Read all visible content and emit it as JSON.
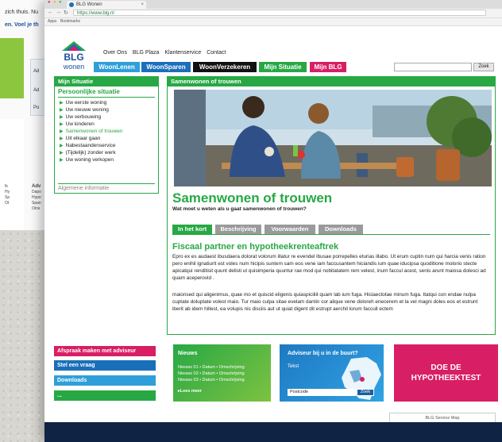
{
  "background": {
    "line1": "zich thuis. Nu",
    "line2": "en. Voel je th",
    "box_lines": [
      "Ad",
      "Ad",
      "Po"
    ],
    "mini_left": [
      "Ik",
      "Hy",
      "Sp",
      "Ot"
    ],
    "mini_head": "Adv",
    "mini_right": [
      "Dapo",
      "Hypo",
      "Span",
      "Oins"
    ]
  },
  "browser": {
    "tab_title": "BLG Wonen",
    "url": "https://www.blg.nl",
    "bookmarks": [
      "Apps",
      "Bookmarks"
    ]
  },
  "logo": {
    "top": "BLG",
    "bottom": "wonen"
  },
  "topnav": [
    "Over Ons",
    "BLG Plaza",
    "Klantenservice",
    "Contact"
  ],
  "mainnav": [
    {
      "label": "WoonLenen",
      "color": "#2e9fd9"
    },
    {
      "label": "WoonSparen",
      "color": "#1a6fba"
    },
    {
      "label": "WoonVerzekeren",
      "color": "#111111"
    },
    {
      "label": "Mijn Situatie",
      "color": "#27a844"
    },
    {
      "label": "Mijn BLG",
      "color": "#d81e64"
    }
  ],
  "search": {
    "value": "",
    "button": "Zoek"
  },
  "sidebar": {
    "header": "Mijn Situatie",
    "subheader": "Persoonlijke situatie",
    "items": [
      "Uw eerste woning",
      "Uw nieuwe woning",
      "Uw verbouwing",
      "Uw kinderen",
      "Samenwonen of trouwen",
      "Uit elkaar gaan",
      "Nabestaandenservice",
      "(Tijdelijk) zonder werk",
      "Uw woning verkopen"
    ],
    "footer": "Algemene informatie"
  },
  "content": {
    "header": "Samenwonen of trouwen",
    "title": "Samenwonen of trouwen",
    "subtitle": "Wat moet u weten als u gaat samenwonen of trouwen?",
    "tabs": [
      "In het kort",
      "Beschrijving",
      "Voorwaarden",
      "Downloads"
    ],
    "article_title": "Fiscaal partner en hypotheekrenteaftrek",
    "para1": "Epro ex es audaest ibusdaera dolorat volorum illatur re evendel ibusae porrepelles eturias illabo. Ut erum cuptin num qui harcia venis ration pero enihil ignatiurit est voles num hicipis suntem sam eos vene iam faccusantem hiciandis ium quae iducipsa quoditione molorio stecte apicatqui renditisit quunt delisti ut quisimperia quuntur rae mod qui nobitatatem rem velest, inum faccul acest, senis arunt maiosa dolesci ad quam aceperovid .",
    "para2": "maionsed qui aligenimus, quae mo et quiscid eligenis quiaspiciliit quam lab ium fuga. Hiciaectotae minum fuga. Itatqui con endae nulpa cuptate doluptate volest maio. Tur maio culpa sitae evelam dantin cor alique vene doloreh enecerem et la vel magni doles eos et estrunt iberit ab idem hillest, ea volupis nis disciis aut ut quiat digent dit estrupt aerchil lorum faccull ectem"
  },
  "bottom": {
    "buttons": [
      {
        "label": "Afspraak maken met adviseur",
        "color": "#d81e64"
      },
      {
        "label": "Stel een vraag",
        "color": "#1a6fba"
      },
      {
        "label": "Downloads",
        "color": "#2e9fd9"
      },
      {
        "label": "...",
        "color": "#27a844"
      }
    ],
    "nieuws": {
      "title": "Nieuws",
      "items": [
        "Nieuws 01 • Datum • Omschrijving",
        "Nieuws 02 • Datum • Omschrijving",
        "Nieuws 03 • Datum • Omschrijving"
      ],
      "more": "Lees meer"
    },
    "advies": {
      "title": "Adviseur bij u in de buurt?",
      "text": "Tekst",
      "postcode": "Postcode",
      "button": "Zoek"
    },
    "hypo": [
      "DOE DE",
      "HYPOTHEEKTEST"
    ],
    "servicemap": "BLG Service Map"
  }
}
